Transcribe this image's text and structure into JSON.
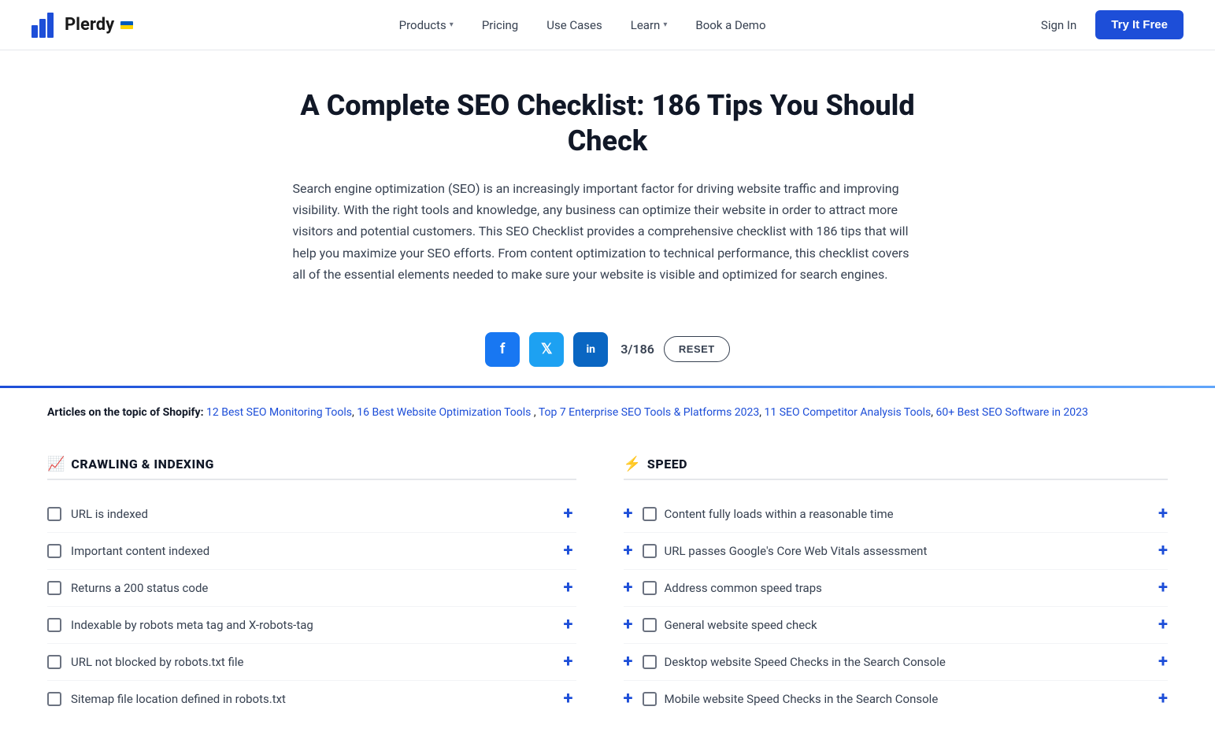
{
  "header": {
    "logo_text": "Plerdy",
    "nav_items": [
      {
        "label": "Products",
        "has_dropdown": true
      },
      {
        "label": "Pricing",
        "has_dropdown": false
      },
      {
        "label": "Use Cases",
        "has_dropdown": false
      },
      {
        "label": "Learn",
        "has_dropdown": true
      },
      {
        "label": "Book a Demo",
        "has_dropdown": false
      }
    ],
    "sign_in": "Sign In",
    "try_free": "Try It Free"
  },
  "hero": {
    "title": "A Complete SEO Checklist: 186 Tips You Should Check",
    "description": "Search engine optimization (SEO) is an increasingly important factor for driving website traffic and improving visibility. With the right tools and knowledge, any business can optimize their website in order to attract more visitors and potential customers. This SEO Checklist provides a comprehensive checklist with 186 tips that will help you maximize your SEO efforts. From content optimization to technical performance, this checklist covers all of the essential elements needed to make sure your website is visible and optimized for search engines."
  },
  "social": {
    "counter": "3/186",
    "reset_label": "RESET"
  },
  "articles": {
    "prefix": "Articles on the topic of Shopify:",
    "links": [
      "12 Best SEO Monitoring Tools",
      "16 Best Website Optimization Tools",
      "Top 7 Enterprise SEO Tools & Platforms 2023",
      "11 SEO Competitor Analysis Tools",
      "60+ Best SEO Software in 2023"
    ]
  },
  "crawling_section": {
    "icon": "📈",
    "title": "CRAWLING & INDEXING",
    "items": [
      "URL is indexed",
      "Important content indexed",
      "Returns a 200 status code",
      "Indexable by robots meta tag and X-robots-tag",
      "URL not blocked by robots.txt file",
      "Sitemap file location defined in robots.txt"
    ]
  },
  "speed_section": {
    "icon": "⚡",
    "title": "SPEED",
    "items": [
      "Content fully loads within a reasonable time",
      "URL passes Google's Core Web Vitals assessment",
      "Address common speed traps",
      "General website speed check",
      "Desktop website Speed Checks in the Search Console",
      "Mobile website Speed Checks in the Search Console"
    ]
  }
}
